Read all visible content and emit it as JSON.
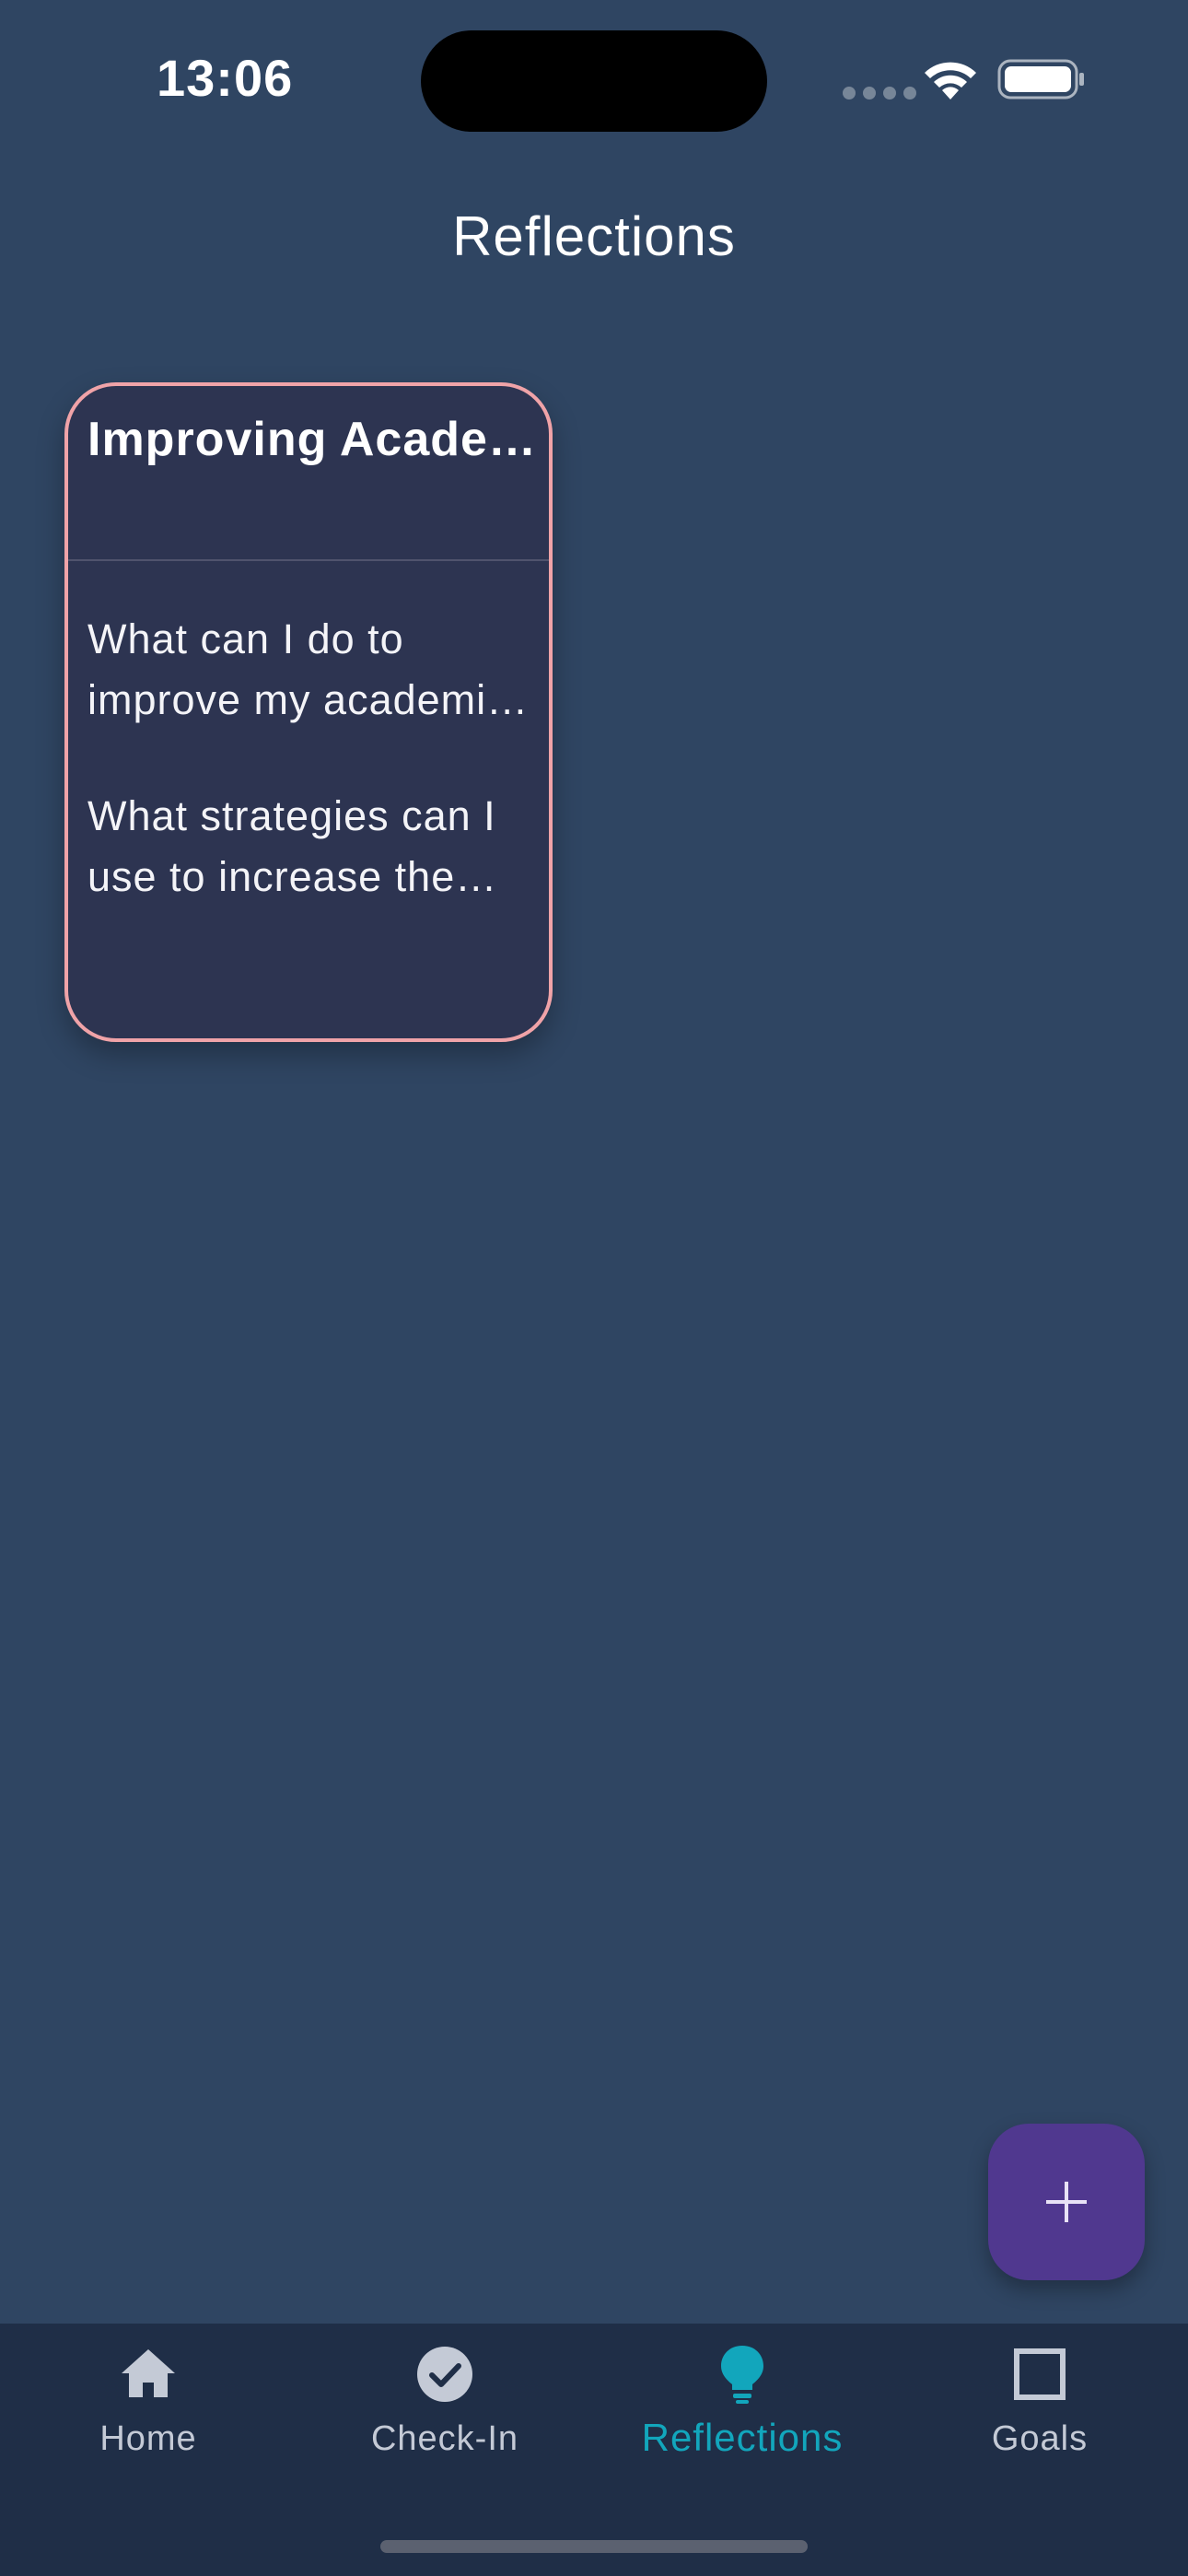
{
  "status_bar": {
    "time": "13:06",
    "icons": [
      "cellular-signal-icon",
      "wifi-icon",
      "battery-icon"
    ]
  },
  "header": {
    "title": "Reflections"
  },
  "reflections": [
    {
      "title": "Improving Academic Performance",
      "questions": [
        "What can I do to improve my academic performance?",
        "What strategies can I use to increase the amount of time I study?"
      ]
    }
  ],
  "fab": {
    "icon": "plus-icon"
  },
  "bottom_nav": {
    "items": [
      {
        "label": "Home",
        "icon": "home-icon"
      },
      {
        "label": "Check-In",
        "icon": "check-circle-icon"
      },
      {
        "label": "Reflections",
        "icon": "lightbulb-icon",
        "active": true
      },
      {
        "label": "Goals",
        "icon": "square-icon"
      }
    ]
  },
  "colors": {
    "background": "#2f4562",
    "card_background": "#2d3451",
    "card_border": "#f0a3a8",
    "fab": "#50388f",
    "nav_background": "#1f2e47",
    "nav_active": "#12a6bc",
    "nav_inactive": "#c4cad6"
  }
}
